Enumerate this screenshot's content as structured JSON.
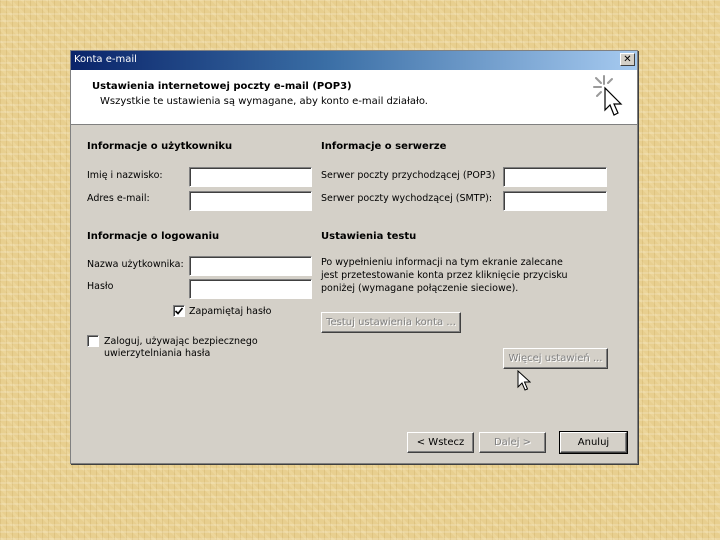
{
  "window": {
    "title": "Konta e-mail",
    "close_glyph": "✕"
  },
  "header": {
    "title": "Ustawienia internetowej poczty e-mail (POP3)",
    "subtitle": "Wszystkie te ustawienia są wymagane, aby konto e-mail działało."
  },
  "user_info": {
    "title": "Informacje o użytkowniku",
    "name_label": "Imię i nazwisko:",
    "name_value": "",
    "email_label": "Adres e-mail:",
    "email_value": ""
  },
  "server_info": {
    "title": "Informacje o serwerze",
    "incoming_label": "Serwer poczty przychodzącej (POP3)",
    "incoming_value": "",
    "outgoing_label": "Serwer poczty wychodzącej (SMTP):",
    "outgoing_value": ""
  },
  "logon_info": {
    "title": "Informacje o logowaniu",
    "username_label": "Nazwa użytkownika:",
    "username_value": "",
    "password_label": "Hasło",
    "password_value": "",
    "remember_password_label": "Zapamiętaj hasło",
    "remember_password_checked": true,
    "spa_label_line1": "Zaloguj, używając bezpiecznego",
    "spa_label_line2": "uwierzytelniania hasła",
    "spa_checked": false
  },
  "test_settings": {
    "title": "Ustawienia testu",
    "description_line1": "Po wypełnieniu informacji na tym ekranie zalecane",
    "description_line2": "jest przetestowanie konta przez kliknięcie przycisku",
    "description_line3": "poniżej (wymagane połączenie sieciowe).",
    "test_button_label": "Testuj ustawienia konta ...",
    "more_settings_label": "Więcej ustawień ..."
  },
  "footer": {
    "back_label": "< Wstecz",
    "next_label": "Dalej >",
    "cancel_label": "Anuluj"
  },
  "icons": {
    "close": "close-icon",
    "wizard": "cursor-sparkle-icon",
    "check": "checkmark-icon",
    "mouse": "mouse-pointer-icon"
  },
  "colors": {
    "titlebar_start": "#0a246a",
    "titlebar_end": "#a6caf0",
    "dialog_face": "#d4d0c8",
    "page_background": "#e8cf8f"
  }
}
